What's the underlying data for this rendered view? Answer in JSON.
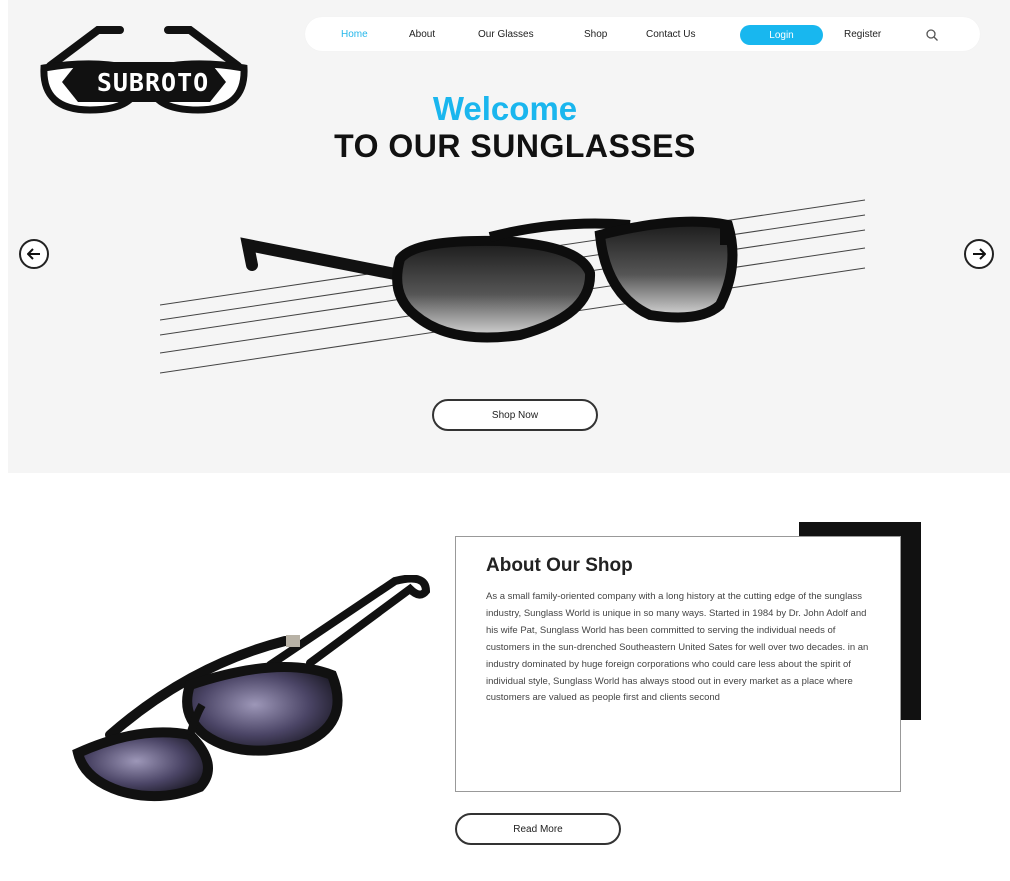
{
  "brand": {
    "logo_text": "SUBROTO"
  },
  "nav": {
    "items": [
      {
        "label": "Home"
      },
      {
        "label": "About"
      },
      {
        "label": "Our Glasses"
      },
      {
        "label": "Shop"
      },
      {
        "label": "Contact Us"
      },
      {
        "label": "Login"
      },
      {
        "label": "Register"
      }
    ],
    "search_icon": "search-icon"
  },
  "hero": {
    "welcome": "Welcome",
    "subheading": "TO OUR SUNGLASSES",
    "shop_button": "Shop Now",
    "prev_icon": "arrow-left-icon",
    "next_icon": "arrow-right-icon"
  },
  "about": {
    "title": "About Our Shop",
    "body": "As a small family-oriented company with a long history at the cutting edge of the sunglass industry, Sunglass World is unique in so many ways. Started in 1984 by Dr. John Adolf and his wife Pat, Sunglass World has been committed to serving the individual needs of customers in the sun-drenched Southeastern United Sates for well over two decades. in an industry dominated by huge foreign corporations who could care less about the spirit of individual style, Sunglass World has always stood out in every market as a place where customers are valued as people first and clients second",
    "read_more": "Read More"
  },
  "colors": {
    "accent": "#18b7ef",
    "hero_bg": "#f5f5f5",
    "dark": "#111111"
  }
}
